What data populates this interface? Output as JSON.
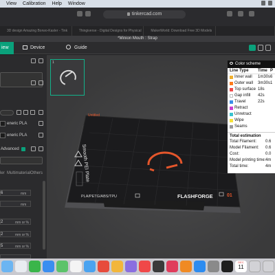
{
  "menubar": {
    "items": [
      "View",
      "Calibration",
      "Help",
      "Window"
    ]
  },
  "browser": {
    "url": "tinkercad.com",
    "tabs": [
      "3D design Amazing Borwo-Kasler - Tink",
      "Thingiverse - Digital Designs for Physical",
      "MakerWorld: Download Free 3D Models",
      ""
    ]
  },
  "app": {
    "title": "*Minion Mouth : Strap",
    "toolbar": {
      "view_label": "iew",
      "device_label": "Device",
      "guide_label": "Guide"
    }
  },
  "left_panel": {
    "material_1": "eneric PLA",
    "material_2": "eneric PLA",
    "advanced_label": "Advanced",
    "tab_multimaterial": "Multimaterial",
    "tab_others": "Others",
    "tab_left": "ler",
    "field_1_value": "6",
    "field_1_unit": "mm",
    "field_2_unit": "mm",
    "field_3_value": "2",
    "field_3_unit": "mm or %",
    "field_4_value": "2",
    "field_4_unit": "mm or %",
    "field_5_value": "5",
    "field_5_unit": "mm or %",
    "field_6_value": "2",
    "field_6_unit": "mm or %",
    "field_7_value": "5",
    "field_7_unit": "mm or %"
  },
  "viewport": {
    "thumbnail_number": "1",
    "plate_name": "Smooth PEI Plate",
    "plate_tag": "Untitled",
    "plate_materials": "PLA/PETG/ABS/TPU",
    "plate_brand": "FLASHFORGE",
    "plate_number": "01"
  },
  "color_scheme": {
    "header": "Color scheme",
    "col_line_type": "Line Type",
    "col_time": "Time",
    "col_percent": "P",
    "rows": [
      {
        "label": "Inner wall",
        "time": "1m30s",
        "pct": "6",
        "color": "#f0b030"
      },
      {
        "label": "Outer wall",
        "time": "3m30s",
        "pct": "1",
        "color": "#ff7b1c"
      },
      {
        "label": "Top surface",
        "time": "18s",
        "pct": "",
        "color": "#f04a4a"
      },
      {
        "label": "Gap infill",
        "time": "42s",
        "pct": "",
        "color": "#ffffff"
      },
      {
        "label": "Travel",
        "time": "22s",
        "pct": "",
        "color": "#3c8ee8"
      },
      {
        "label": "Retract",
        "time": "",
        "pct": "",
        "color": "#c93fd1"
      },
      {
        "label": "Unretract",
        "time": "",
        "pct": "",
        "color": "#39c3cf"
      },
      {
        "label": "Wipe",
        "time": "",
        "pct": "",
        "color": "#f6e23a"
      },
      {
        "label": "Seams",
        "time": "",
        "pct": "",
        "color": "#9a9a9a"
      }
    ],
    "estimation_title": "Total estimation",
    "estimation": [
      {
        "label": "Total Filament:",
        "value": "0.6"
      },
      {
        "label": "Model Filament:",
        "value": "0.6"
      },
      {
        "label": "Cost:",
        "value": "0.0"
      },
      {
        "label": "Model printing time:",
        "value": "4m"
      },
      {
        "label": "Total time:",
        "value": "4m"
      }
    ]
  },
  "dock": {
    "calendar_month": "DEC",
    "calendar_day": "11"
  },
  "colors": {
    "accent": "#0aa17b",
    "object_color": "#e5562b",
    "plate_accent": "#e8572a"
  }
}
